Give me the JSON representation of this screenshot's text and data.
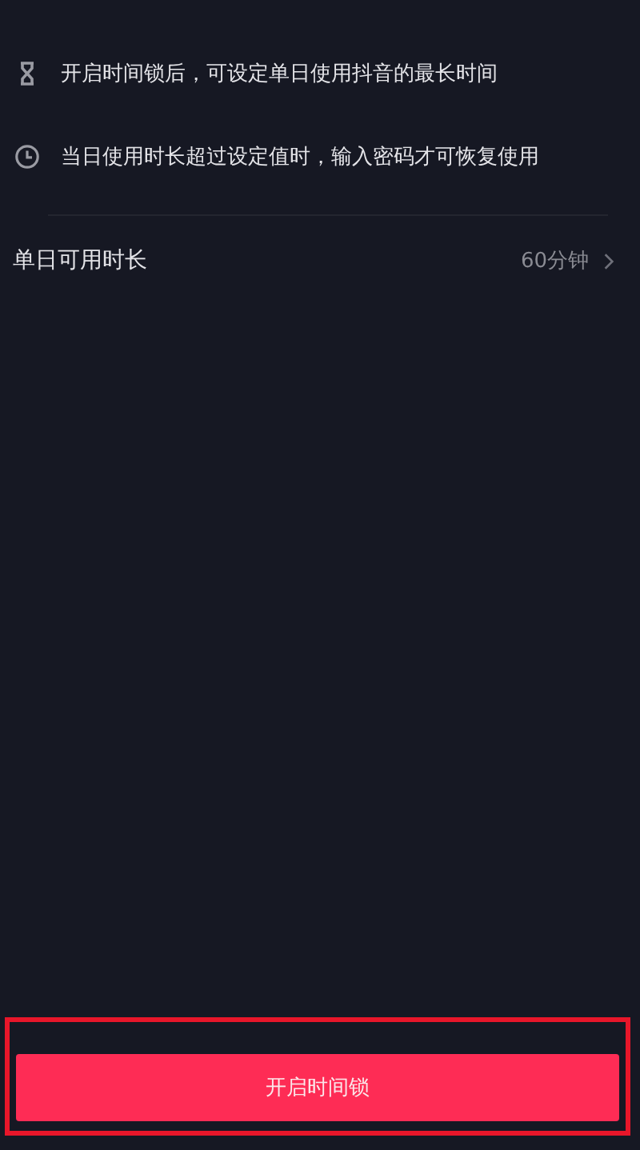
{
  "tips": [
    {
      "kind": "hourglass",
      "text": "开启时间锁后，可设定单日使用抖音的最长时间"
    },
    {
      "kind": "clock",
      "text": "当日使用时长超过设定值时，输入密码才可恢复使用"
    }
  ],
  "setting": {
    "label": "单日可用时长",
    "value": "60分钟"
  },
  "primary_button": {
    "label": "开启时间锁"
  }
}
